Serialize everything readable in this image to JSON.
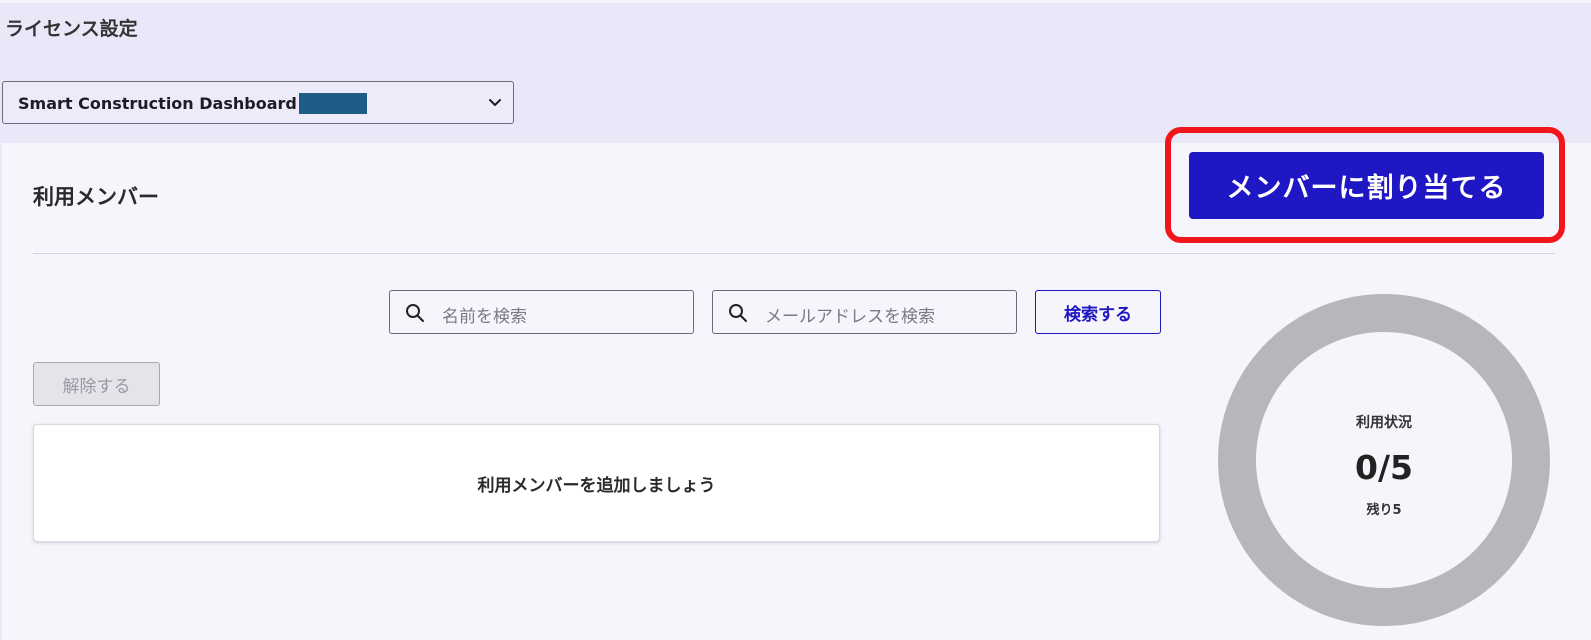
{
  "page": {
    "title": "ライセンス設定"
  },
  "license_select": {
    "value": "Smart Construction Dashboard #",
    "icon": "chevron-down-icon"
  },
  "members": {
    "section_title": "利用メンバー",
    "assign_button": "メンバーに割り当てる",
    "name_search_placeholder": "名前を検索",
    "email_search_placeholder": "メールアドレスを検索",
    "search_button": "検索する",
    "release_button": "解除する",
    "empty_message": "利用メンバーを追加しましょう"
  },
  "usage": {
    "title": "利用状況",
    "value_text": "0/5",
    "remaining_text": "残り5",
    "used": 0,
    "total": 5
  },
  "colors": {
    "accent": "#1f16c4",
    "highlight": "#f0161b",
    "ring": "#b5b7bb",
    "header_bg": "#e9e8f8"
  }
}
